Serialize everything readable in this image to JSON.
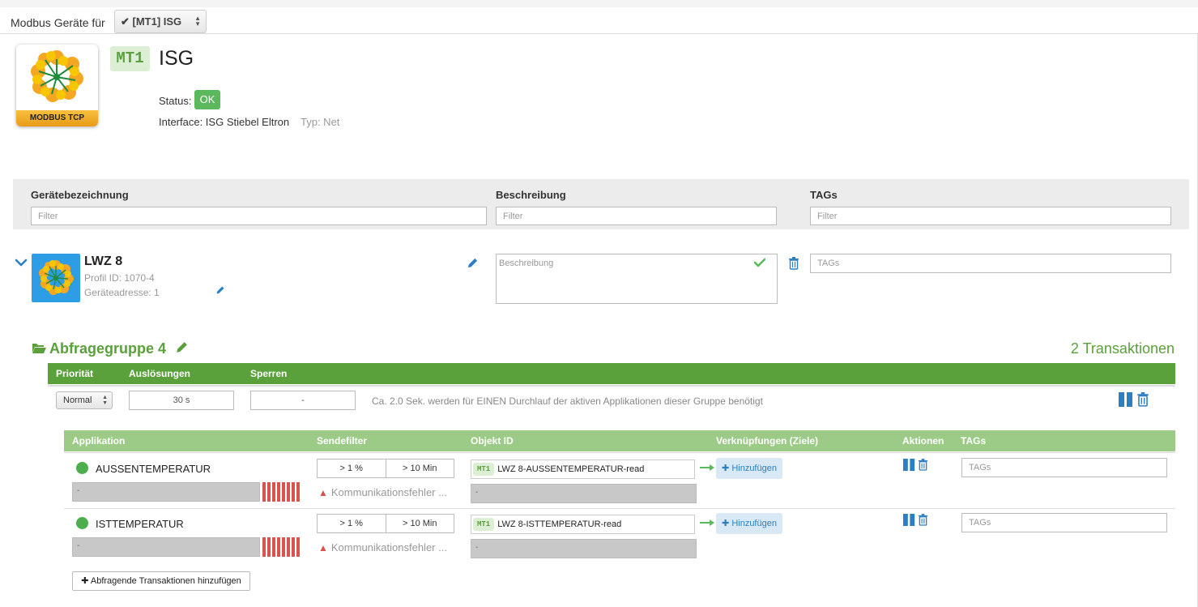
{
  "topbar": {
    "label": "Modbus Geräte für",
    "selector_value": "✔ [MT1] ISG"
  },
  "header": {
    "logo_band": "MODBUS TCP",
    "mt_badge": "MT1",
    "title": "ISG",
    "status_label": "Status:",
    "status_value": "OK",
    "interface": "Interface: ISG Stiebel Eltron",
    "typ": "Typ: Net"
  },
  "filters": {
    "col1_label": "Gerätebezeichnung",
    "col2_label": "Beschreibung",
    "col3_label": "TAGs",
    "placeholder": "Filter"
  },
  "device": {
    "name": "LWZ 8",
    "profile": "Profil ID: 1070-4",
    "address": "Geräteadresse: 1",
    "desc_placeholder": "Beschreibung",
    "tags_placeholder": "TAGs"
  },
  "group": {
    "title": "Abfragegruppe 4",
    "count": "2 Transaktionen",
    "head_priority": "Priorität",
    "head_triggers": "Auslösungen",
    "head_locks": "Sperren",
    "priority_value": "Normal",
    "triggers_value": "30 s",
    "locks_value": "-",
    "note": "Ca. 2.0 Sek. werden für EINEN Durchlauf der aktiven Applikationen dieser Gruppe benötigt"
  },
  "table": {
    "headers": {
      "app": "Applikation",
      "sendfilter": "Sendefilter",
      "objid": "Objekt ID",
      "links": "Verknüpfungen (Ziele)",
      "actions": "Aktionen",
      "tags": "TAGs"
    },
    "rows": [
      {
        "name": "AUSSENTEMPERATUR",
        "status_bar": "-",
        "filter_pct": "> 1 %",
        "filter_time": "> 10 Min",
        "error": "Kommunikationsfehler ...",
        "mt": "MT1",
        "object_id": "LWZ 8-AUSSENTEMPERATUR-read",
        "object_value": "-",
        "add_label": "Hinzufügen",
        "tags_placeholder": "TAGs"
      },
      {
        "name": "ISTTEMPERATUR",
        "status_bar": "-",
        "filter_pct": "> 1 %",
        "filter_time": "> 10 Min",
        "error": "Kommunikationsfehler ...",
        "mt": "MT1",
        "object_id": "LWZ 8-ISTTEMPERATUR-read",
        "object_value": "-",
        "add_label": "Hinzufügen",
        "tags_placeholder": "TAGs"
      }
    ],
    "add_transactions": "Abfragende Transaktionen hinzufügen"
  },
  "colors": {
    "green": "#5aa03b",
    "light_green": "#9ccb87",
    "blue": "#2d7fc4",
    "red": "#d9534f"
  },
  "icons": [
    "checkmark-icon",
    "chevron-down-icon",
    "pencil-icon",
    "trash-icon",
    "pause-icon",
    "folder-open-icon",
    "warning-icon",
    "plus-icon",
    "arrow-right-icon"
  ]
}
